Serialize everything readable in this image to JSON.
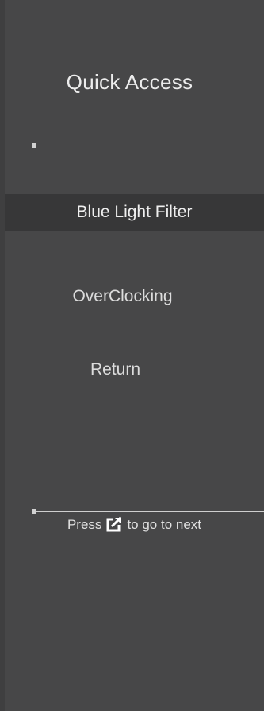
{
  "panel": {
    "title": "Quick Access"
  },
  "menu": {
    "items": [
      {
        "label": "Blue Light Filter",
        "selected": true
      },
      {
        "label": "OverClocking",
        "selected": false
      },
      {
        "label": "Return",
        "selected": false
      }
    ]
  },
  "hint": {
    "prefix": "Press",
    "icon": "external-link-icon",
    "suffix": "to go to next"
  },
  "colors": {
    "panel_bg": "#474748",
    "selected_bg": "#373738",
    "text": "#e8e8e8",
    "divider": "#cfcfcf"
  }
}
